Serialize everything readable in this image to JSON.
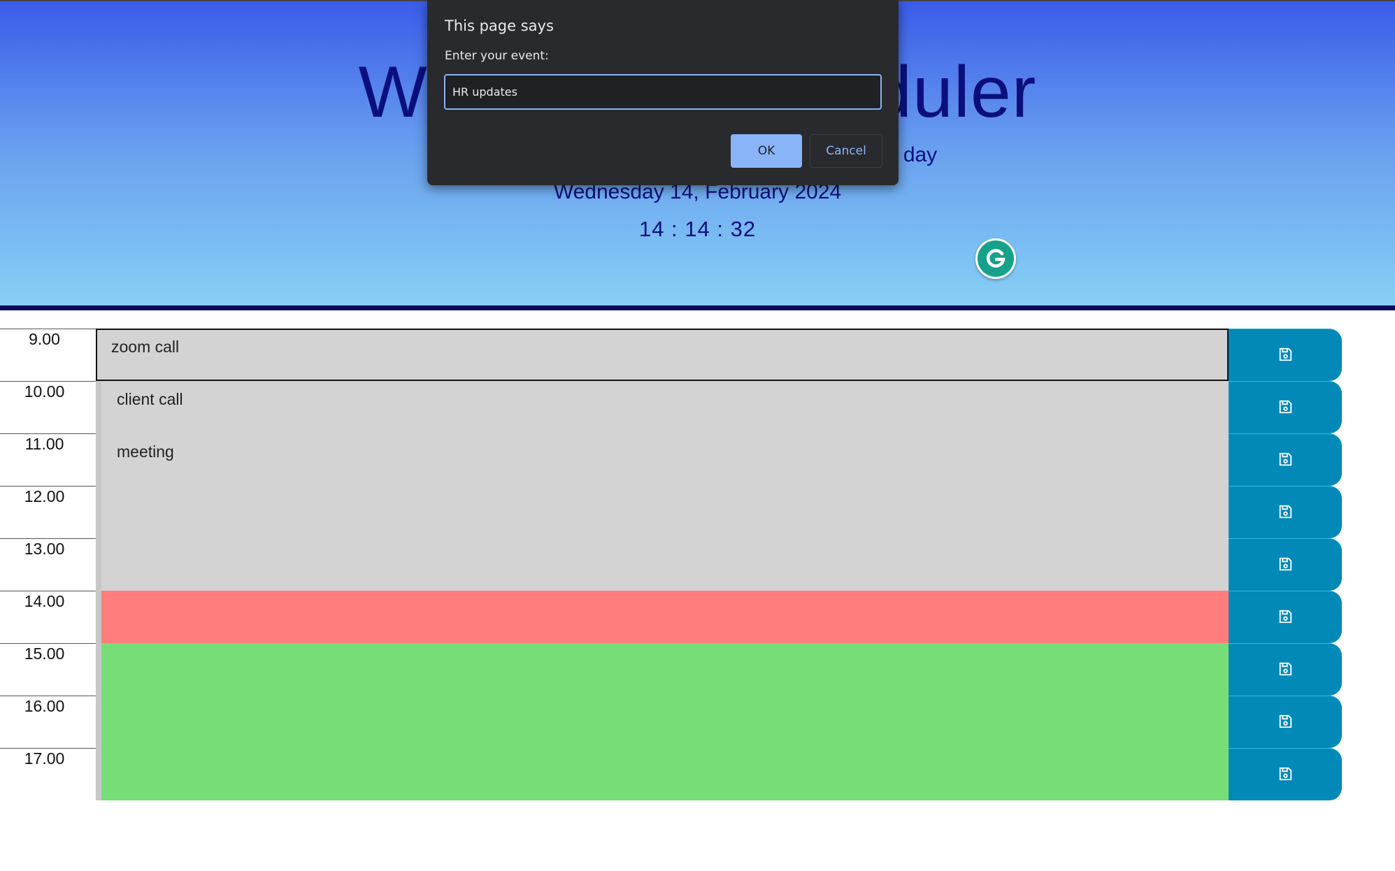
{
  "header": {
    "title": "Work Day Scheduler",
    "subtitle": "A simple calendar app for scheduling your work day",
    "date": "Wednesday 14, February 2024",
    "clock": "14 : 14 : 32"
  },
  "colors": {
    "past": "#d3d3d3",
    "present": "#ff7d7d",
    "future": "#77dd77",
    "save_button": "#0289b8",
    "header_text": "#0b0f7d"
  },
  "schedule": [
    {
      "hour": "9.00",
      "event": "zoom call",
      "state": "past"
    },
    {
      "hour": "10.00",
      "event": "client call",
      "state": "past"
    },
    {
      "hour": "11.00",
      "event": "meeting",
      "state": "past"
    },
    {
      "hour": "12.00",
      "event": "",
      "state": "past"
    },
    {
      "hour": "13.00",
      "event": "",
      "state": "past"
    },
    {
      "hour": "14.00",
      "event": "",
      "state": "present"
    },
    {
      "hour": "15.00",
      "event": "",
      "state": "future"
    },
    {
      "hour": "16.00",
      "event": "",
      "state": "future"
    },
    {
      "hour": "17.00",
      "event": "",
      "state": "future"
    }
  ],
  "save_icon": "floppy-disk-icon",
  "extension_icon": "grammarly-icon",
  "dialog": {
    "title": "This page says",
    "message": "Enter your event:",
    "input_value": "HR updates",
    "ok_label": "OK",
    "cancel_label": "Cancel"
  }
}
